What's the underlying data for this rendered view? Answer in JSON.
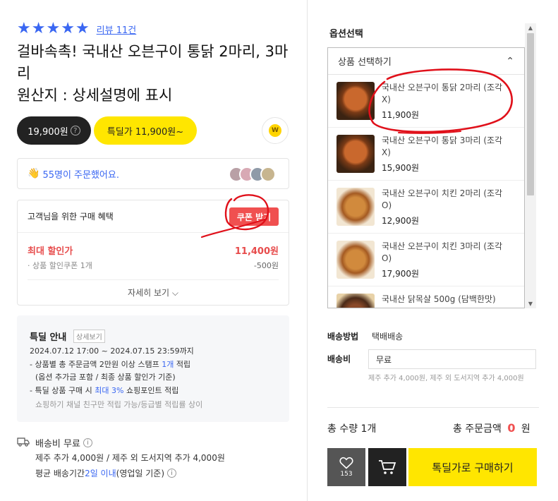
{
  "product": {
    "stars": [
      "★",
      "★",
      "★",
      "★",
      "★"
    ],
    "rating": 5,
    "review_link": "리뷰 11건",
    "title": "걸바속촉! 국내산 오븐구이 통닭 2마리, 3마리\n원산지 : 상세설명에 표시",
    "price": "19,900원",
    "help_icon": "?",
    "deal_price": "특딜가 11,900원~",
    "w_badge": "W",
    "orders_text": "55명이 주문했어요."
  },
  "benefit": {
    "title": "고객님을 위한 구매 혜택",
    "coupon_button": "쿠폰 받기",
    "max_discount_label": "최대 할인가",
    "max_discount_value": "11,400원",
    "coupon_label": "상품 할인쿠폰 1개",
    "coupon_value": "-500원",
    "detail_link": "자세히 보기 ⌵"
  },
  "deal": {
    "title": "특딜 안내",
    "detail_tag": "상세보기",
    "date": "2024.07.12 17:00 ~ 2024.07.15 23:59까지",
    "line1_pre": "- 상품별 총 주문금액 2만원 이상 스탬프 ",
    "line1_blue": "1개",
    "line1_post": " 적립",
    "line2": "(옵션 추가금 포함 / 최종 상품 할인가 기준)",
    "line3_pre": "- 특딜 상품 구매 시 ",
    "line3_blue": "최대 3%",
    "line3_post": " 쇼핑포인트 적립",
    "note": "쇼핑하기 채널 친구만 적립 가능/등급별 적립률 상이"
  },
  "shipping_info": {
    "free": "배송비 무료",
    "extra": "제주 추가 4,000원 / 제주 외 도서지역 추가 4,000원",
    "avg_pre": "평균 배송기간 ",
    "avg_blue": "2일 이내",
    "avg_post": " (영업일 기준)",
    "info_icon": "i"
  },
  "options": {
    "section_label": "옵션선택",
    "dropdown_label": "상품 선택하기",
    "chevron": "⌃",
    "items": [
      {
        "name": "국내산 오븐구이 통닭 2마리 (조각X)",
        "price": "11,900원"
      },
      {
        "name": "국내산 오븐구이 통닭 3마리 (조각X)",
        "price": "15,900원"
      },
      {
        "name": "국내산 오븐구이 치킨 2마리 (조각O)",
        "price": "12,900원"
      },
      {
        "name": "국내산 오븐구이 치킨 3마리 (조각O)",
        "price": "17,900원"
      },
      {
        "name": "국내산 닭목살 500g (담백한맛)",
        "price": ""
      }
    ],
    "scroll_up": "▲",
    "scroll_down": "▼"
  },
  "delivery": {
    "method_label": "배송방법",
    "method_value": "택배배송",
    "fee_label": "배송비",
    "fee_value": "무료",
    "fee_note": "제주 추가 4,000원, 제주 외 도서지역 추가 4,000원"
  },
  "summary": {
    "qty": "총 수량 1개",
    "total_label": "총 주문금액",
    "total_value": "0",
    "total_unit": "원"
  },
  "actions": {
    "wish_count": "153",
    "buy_label": "톡딜가로 구매하기"
  },
  "colors": {
    "accent_blue": "#3a67f2",
    "deal_yellow": "#ffe600",
    "coupon_red": "#f05050",
    "annotation_red": "#e0101a"
  }
}
